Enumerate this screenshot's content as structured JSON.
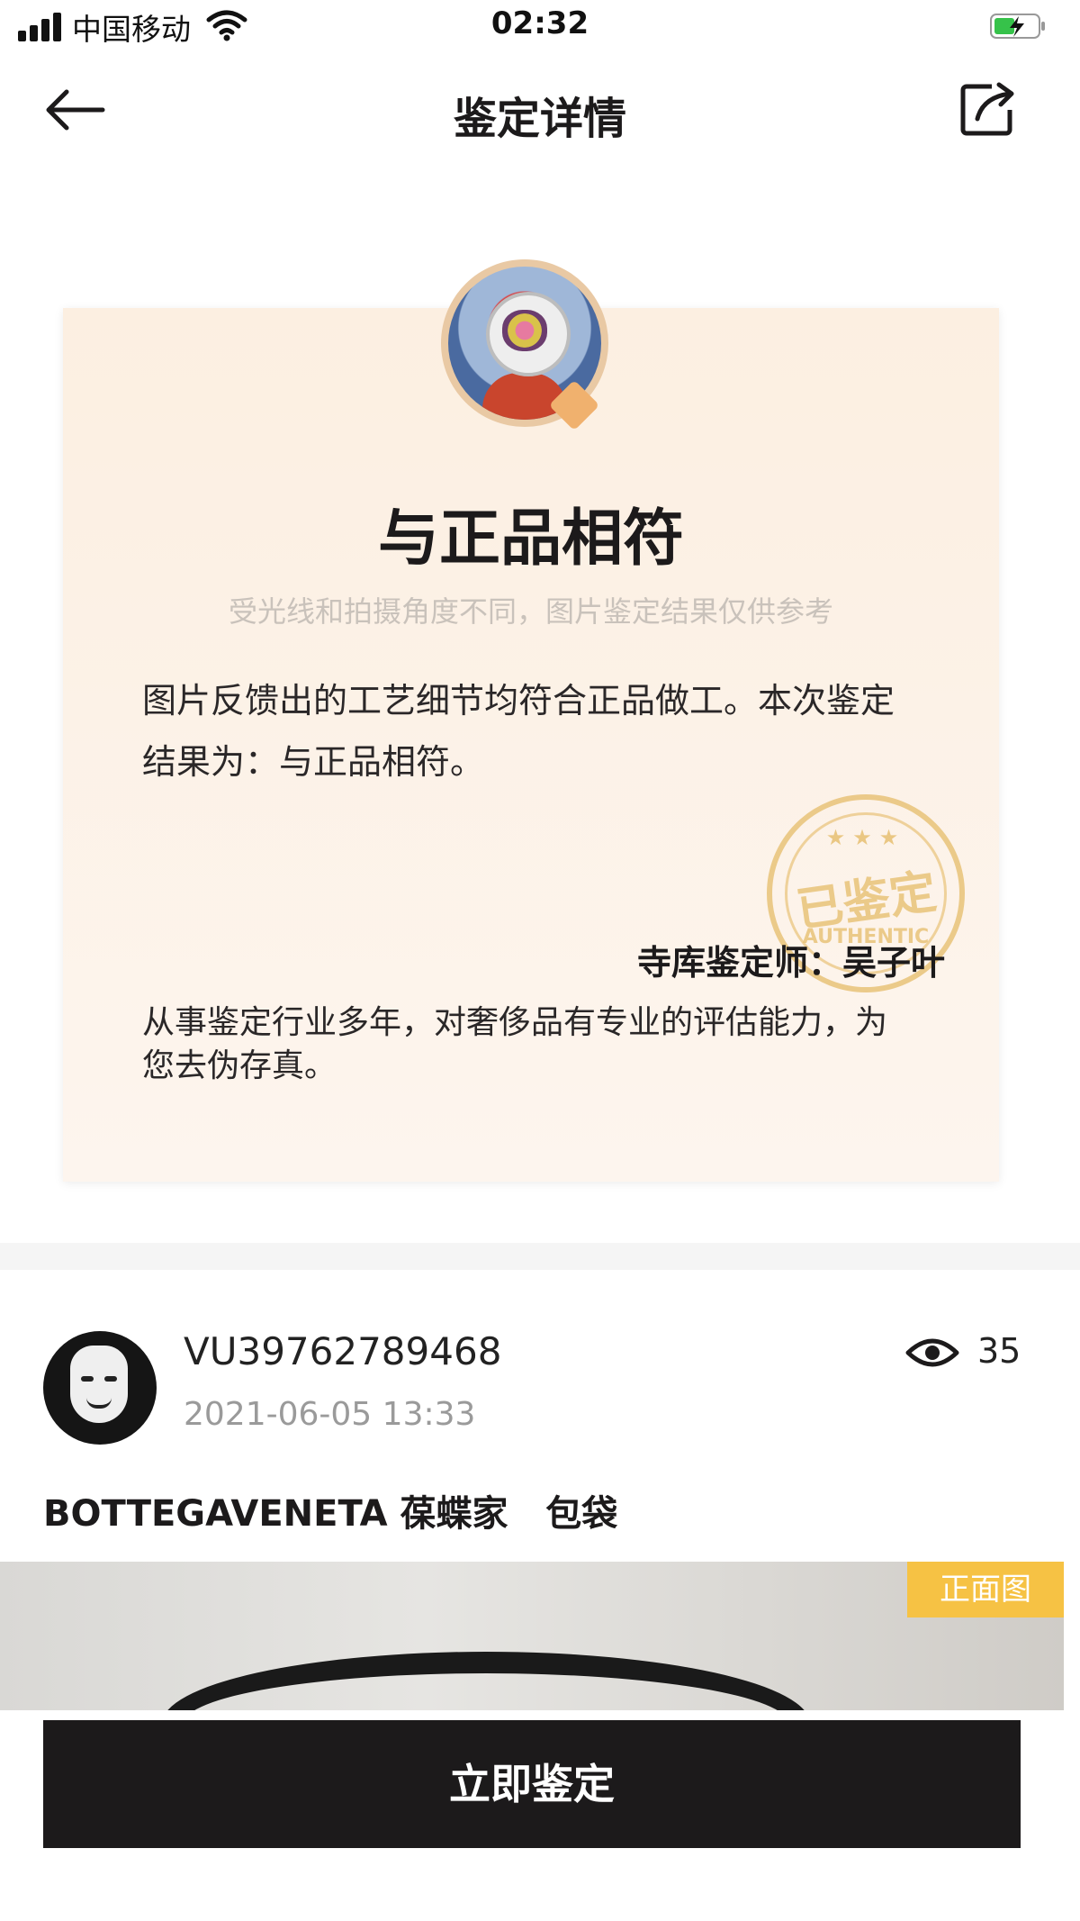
{
  "status_bar": {
    "carrier": "中国移动",
    "time": "02:32"
  },
  "nav": {
    "title": "鉴定详情"
  },
  "result_card": {
    "result": "与正品相符",
    "disclaimer": "受光线和拍摄角度不同，图片鉴定结果仅供参考",
    "description": "图片反馈出的工艺细节均符合正品做工。本次鉴定结果为：与正品相符。",
    "stamp_text": "已鉴定",
    "stamp_sub": "AUTHENTIC",
    "appraiser": "寺库鉴定师：吴子叶",
    "bio": "从事鉴定行业多年，对奢侈品有专业的评估能力，为您去伪存真。"
  },
  "post": {
    "username": "VU39762789468",
    "timestamp": "2021-06-05 13:33",
    "views": "35",
    "product_title": "BOTTEGAVENETA 葆蝶家   包袋",
    "photo_tag": "正面图"
  },
  "cta": {
    "label": "立即鉴定"
  },
  "colors": {
    "card_bg": "#fcefe1",
    "cta_bg": "#1c1a1b",
    "tag_bg": "#f6c244",
    "stamp": "#e8c278"
  },
  "icons": {
    "back": "arrow-left-icon",
    "share": "share-icon",
    "views": "eye-icon"
  }
}
